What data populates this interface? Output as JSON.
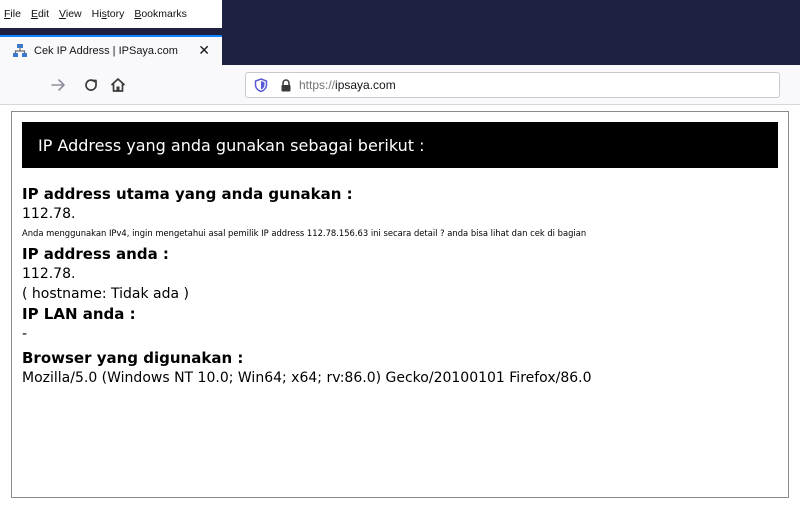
{
  "browser": {
    "menu": [
      {
        "accel": "F",
        "rest": "ile"
      },
      {
        "accel": "E",
        "rest": "dit"
      },
      {
        "accel": "V",
        "rest": "iew"
      },
      {
        "pre": "Hi",
        "accel": "s",
        "rest": "tory"
      },
      {
        "accel": "B",
        "rest": "ookmarks"
      }
    ],
    "tab_title": "Cek IP Address | IPSaya.com",
    "tab_close": "✕",
    "url_scheme": "https://",
    "url_host": "ipsaya.com",
    "icons": {
      "back": "back-arrow-icon",
      "reload": "reload-icon",
      "home": "home-icon",
      "shield": "tracking-shield-icon",
      "lock": "lock-icon"
    },
    "accent_color": "#0a84ff",
    "chrome_color": "#1f2140"
  },
  "page": {
    "header": "IP Address yang anda gunakan sebagai berikut :",
    "main_ip_label": "IP address utama yang anda gunakan :",
    "main_ip_value": "112.78.",
    "ipv4_note": "Anda menggunakan IPv4, ingin mengetahui asal pemilik IP address 112.78.156.63 ini secara detail ? anda bisa lihat dan cek di bagian",
    "ip_label": "IP address anda :",
    "ip_value": "112.78.",
    "hostname": "( hostname: Tidak ada )",
    "lan_label": "IP LAN anda :",
    "lan_value": "-",
    "browser_label": "Browser yang digunakan :",
    "user_agent": "Mozilla/5.0 (Windows NT 10.0; Win64; x64; rv:86.0) Gecko/20100101 Firefox/86.0"
  }
}
